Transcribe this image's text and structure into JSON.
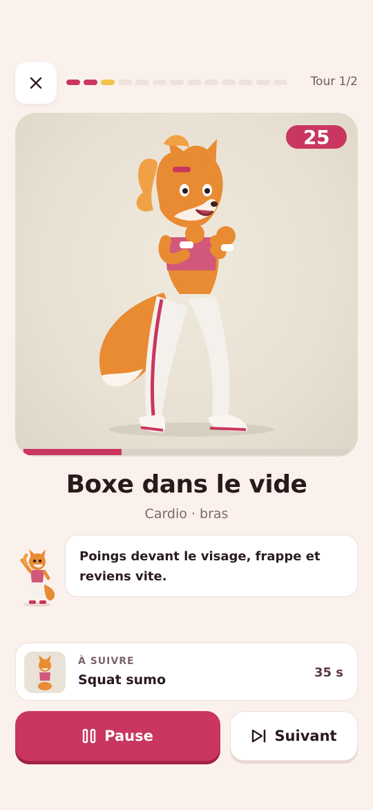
{
  "header": {
    "close_icon": "close-icon",
    "progress": {
      "total": 13,
      "completed": 2,
      "current": 3,
      "completed_color": "#c9365f",
      "current_color": "#f2c24a",
      "pending_color": "#f0e1da"
    },
    "round_label": "Tour 1/2"
  },
  "exercise": {
    "timer": "25",
    "elapsed_fraction": 0.3,
    "title": "Boxe dans le vide",
    "subtitle": "Cardio · bras"
  },
  "coach": {
    "message": "Poings devant le visage, frappe et reviens vite."
  },
  "next_up": {
    "label": "À SUIVRE",
    "name": "Squat sumo",
    "duration": "35 s"
  },
  "actions": {
    "pause_label": "Pause",
    "pause_icon": "pause-icon",
    "next_label": "Suivant",
    "next_icon": "skip-next-icon"
  },
  "colors": {
    "accent": "#c9365f",
    "background": "#fbf1ec"
  }
}
